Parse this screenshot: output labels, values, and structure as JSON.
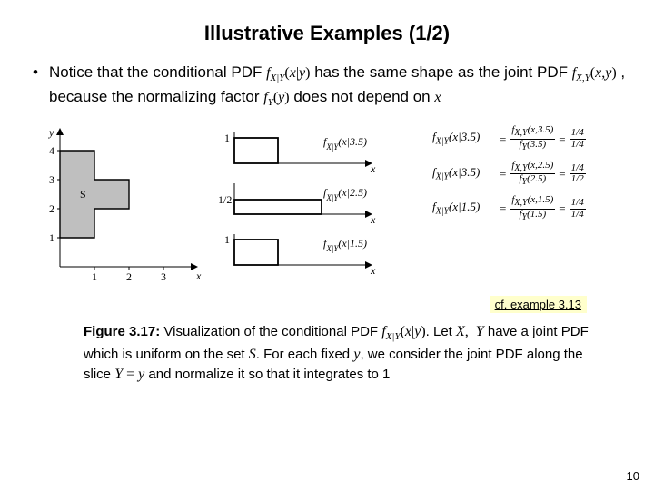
{
  "title": "Illustrative Examples (1/2)",
  "bullet": {
    "t1": "Notice that the conditional PDF ",
    "m1": "f_{X|Y}(x|y)",
    "t2": " has the same shape as the joint PDF ",
    "m2": "f_{X,Y}(x,y)",
    "t3": " , because the normalizing factor ",
    "m3": "f_{Y}(y)",
    "t4": " does not depend on ",
    "m4": "x"
  },
  "chart_data": {
    "type": "area",
    "title": "Region S (uniform joint PDF support)",
    "xlabel": "x",
    "ylabel": "y",
    "xlim": [
      0,
      3.5
    ],
    "ylim": [
      0,
      4.5
    ],
    "xticks": [
      1,
      2,
      3
    ],
    "yticks": [
      1,
      2,
      3,
      4
    ],
    "region_S_polygon": [
      [
        0,
        1
      ],
      [
        1,
        1
      ],
      [
        1,
        2
      ],
      [
        2,
        2
      ],
      [
        2,
        3
      ],
      [
        1,
        3
      ],
      [
        1,
        4
      ],
      [
        0,
        4
      ]
    ],
    "region_label": "S",
    "slices": [
      {
        "label": "f_{X|Y}(x|3.5)",
        "y": 3.5,
        "support": [
          0,
          1
        ],
        "height": 1
      },
      {
        "label": "f_{X|Y}(x|2.5)",
        "y": 2.5,
        "support": [
          0,
          2
        ],
        "height": 0.5
      },
      {
        "label": "f_{X|Y}(x|1.5)",
        "y": 1.5,
        "support": [
          0,
          1
        ],
        "height": 1
      }
    ],
    "equations": [
      {
        "lhs": "f_{X|Y}(x|3.5)",
        "num": "f_{X,Y}(x,3.5)",
        "den": "f_{Y}(3.5)",
        "rhs_num": "1/4",
        "rhs_den": "1/4"
      },
      {
        "lhs": "f_{X|Y}(x|3.5)",
        "num": "f_{X,Y}(x,2.5)",
        "den": "f_{Y}(2.5)",
        "rhs_num": "1/4",
        "rhs_den": "1/2"
      },
      {
        "lhs": "f_{X|Y}(x|1.5)",
        "num": "f_{X,Y}(x,1.5)",
        "den": "f_{Y}(1.5)",
        "rhs_num": "1/4",
        "rhs_den": "1/4"
      }
    ]
  },
  "cf_note": "cf. example 3.13",
  "caption": {
    "figlabel": "Figure 3.17:",
    "t1": " Visualization of the conditional PDF ",
    "m1": "f_{X|Y}(x|y)",
    "t2": ". Let ",
    "m2": "X, Y",
    "t3": " have a joint PDF which is uniform on the set ",
    "m3": "S",
    "t4": ". For each fixed ",
    "m4": "y",
    "t5": ", we consider the joint PDF along the slice ",
    "m5": "Y = y",
    "t6": " and normalize it so that it integrates to 1"
  },
  "page_number": "10"
}
